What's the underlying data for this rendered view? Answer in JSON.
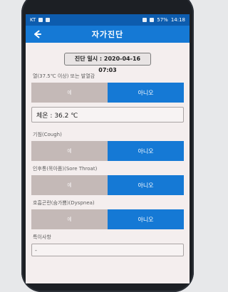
{
  "status_bar": {
    "left": "KT",
    "right": "57%",
    "time": "14:18"
  },
  "appbar": {
    "title": "자가진단"
  },
  "diagnosis_time": "진단 일시 : 2020-04-16 07:03",
  "questions": [
    {
      "label": "열(37.5℃ 이상) 또는 발열감",
      "yes": "예",
      "no": "아니오"
    },
    {
      "label": "기침(Cough)",
      "yes": "예",
      "no": "아니오"
    },
    {
      "label": "인후통(목아픔)(Sore Throat)",
      "yes": "예",
      "no": "아니오"
    },
    {
      "label": "호흡곤란(숨가쁨)(Dyspnea)",
      "yes": "예",
      "no": "아니오"
    }
  ],
  "temperature": "체온 : 36.2 ℃",
  "notes": {
    "label": "특이사항",
    "value": "-"
  },
  "colors": {
    "primary": "#1579d5",
    "status": "#0d5cae",
    "toggle_off": "#c4b9b7"
  }
}
